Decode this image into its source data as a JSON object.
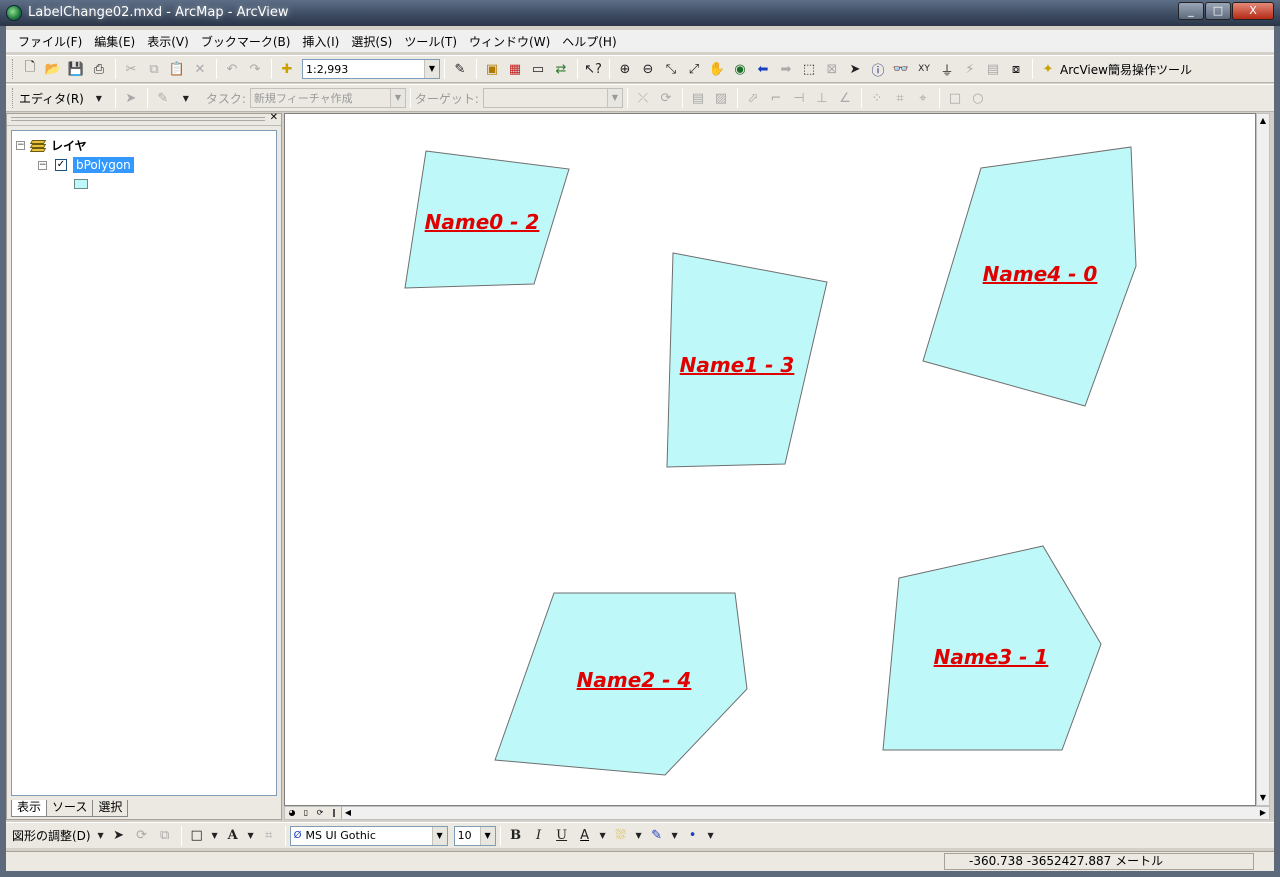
{
  "window": {
    "title": "LabelChange02.mxd - ArcMap - ArcView",
    "buttons": [
      "_",
      "□",
      "X"
    ]
  },
  "menu": [
    "ファイル(F)",
    "編集(E)",
    "表示(V)",
    "ブックマーク(B)",
    "挿入(I)",
    "選択(S)",
    "ツール(T)",
    "ウィンドウ(W)",
    "ヘルプ(H)"
  ],
  "toolbar1": {
    "scale": "1:2,993",
    "custom_tool": "ArcView簡易操作ツール"
  },
  "toolbar2": {
    "editor": "エディタ(R)",
    "task_label": "タスク:",
    "task_value": "新規フィーチャ作成",
    "target_label": "ターゲット:",
    "target_value": ""
  },
  "toc": {
    "root": "レイヤ",
    "layer": "bPolygon",
    "tabs": [
      "表示",
      "ソース",
      "選択"
    ]
  },
  "map": {
    "fill_color": "#bff8f8",
    "label_color": "#e00000",
    "labels": [
      "Name0 - 2",
      "Name1 - 3",
      "Name4 - 0",
      "Name2 - 4",
      "Name3 - 1"
    ]
  },
  "drawbar": {
    "drawing": "図形の調整(D)",
    "font": "MS UI Gothic",
    "size": "10",
    "bold": "B",
    "italic": "I",
    "underline": "U",
    "text_tool": "A"
  },
  "status": {
    "coords": "-360.738  -3652427.887 メートル"
  }
}
